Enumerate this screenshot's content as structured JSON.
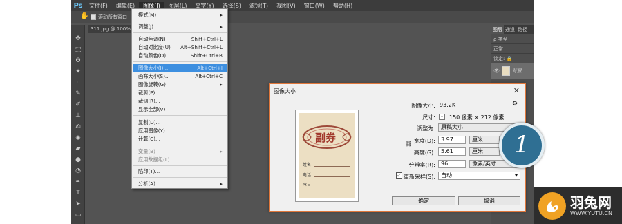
{
  "app": {
    "logo": "Ps",
    "menus": [
      "文件(F)",
      "编辑(E)",
      "图像(I)",
      "图层(L)",
      "文字(Y)",
      "选择(S)",
      "滤镜(T)",
      "视图(V)",
      "窗口(W)",
      "帮助(H)"
    ],
    "active_menu_index": 2,
    "options_checkbox_label": "滚动所有窗口",
    "doc_tab": "311.jpg @ 100%(R"
  },
  "tools": [
    "move-icon",
    "marquee-icon",
    "lasso-icon",
    "wand-icon",
    "crop-icon",
    "eyedropper-icon",
    "brush-icon",
    "stamp-icon",
    "history-brush-icon",
    "eraser-icon",
    "gradient-icon",
    "blur-icon",
    "dodge-icon",
    "pen-icon",
    "type-icon",
    "path-select-icon",
    "shape-icon"
  ],
  "panel": {
    "tabs": [
      "图层",
      "通道",
      "路径"
    ],
    "kind": "类型",
    "blend": "正常",
    "lock": "锁定:",
    "layer_name": "背景"
  },
  "image_menu": {
    "items": [
      {
        "label": "模式(M)",
        "shortcut": "",
        "sub": "▸"
      },
      {
        "label": "调整(J)",
        "shortcut": "",
        "sub": "▸"
      },
      {
        "label": "自动色调(N)",
        "shortcut": "Shift+Ctrl+L",
        "sub": ""
      },
      {
        "label": "自动对比度(U)",
        "shortcut": "Alt+Shift+Ctrl+L",
        "sub": ""
      },
      {
        "label": "自动颜色(O)",
        "shortcut": "Shift+Ctrl+B",
        "sub": ""
      },
      {
        "label": "图像大小(I)...",
        "shortcut": "Alt+Ctrl+I",
        "sub": ""
      },
      {
        "label": "画布大小(S)...",
        "shortcut": "Alt+Ctrl+C",
        "sub": ""
      },
      {
        "label": "图像旋转(G)",
        "shortcut": "",
        "sub": "▸"
      },
      {
        "label": "裁剪(P)",
        "shortcut": "",
        "sub": ""
      },
      {
        "label": "裁切(R)...",
        "shortcut": "",
        "sub": ""
      },
      {
        "label": "显示全部(V)",
        "shortcut": "",
        "sub": ""
      },
      {
        "label": "复制(D)...",
        "shortcut": "",
        "sub": ""
      },
      {
        "label": "应用图像(Y)...",
        "shortcut": "",
        "sub": ""
      },
      {
        "label": "计算(C)...",
        "shortcut": "",
        "sub": ""
      },
      {
        "label": "变量(B)",
        "shortcut": "",
        "sub": "▸"
      },
      {
        "label": "应用数据组(L)...",
        "shortcut": "",
        "sub": ""
      },
      {
        "label": "陷印(T)...",
        "shortcut": "",
        "sub": ""
      },
      {
        "label": "分析(A)",
        "shortcut": "",
        "sub": "▸"
      }
    ]
  },
  "dialog": {
    "title": "图像大小",
    "size_label": "图像大小:",
    "size_value": "93.2K",
    "dims_label": "尺寸:",
    "dims_value": "150 像素 × 212 像素",
    "fit_label": "调整为:",
    "fit_value": "原稿大小",
    "width_label": "宽度(D):",
    "width_value": "3.97",
    "width_unit": "厘米",
    "height_label": "高度(G):",
    "height_value": "5.61",
    "height_unit": "厘米",
    "res_label": "分辨率(R):",
    "res_value": "96",
    "res_unit": "像素/英寸",
    "resample_label": "重新采样(S):",
    "resample_value": "自动",
    "ok": "确定",
    "cancel": "取消",
    "preview": {
      "title": "副券",
      "fields": [
        "姓名",
        "电话",
        "序号"
      ]
    }
  },
  "badge": "1",
  "brand": {
    "name": "羽兔网",
    "url": "WWW.YUTU.CN"
  }
}
